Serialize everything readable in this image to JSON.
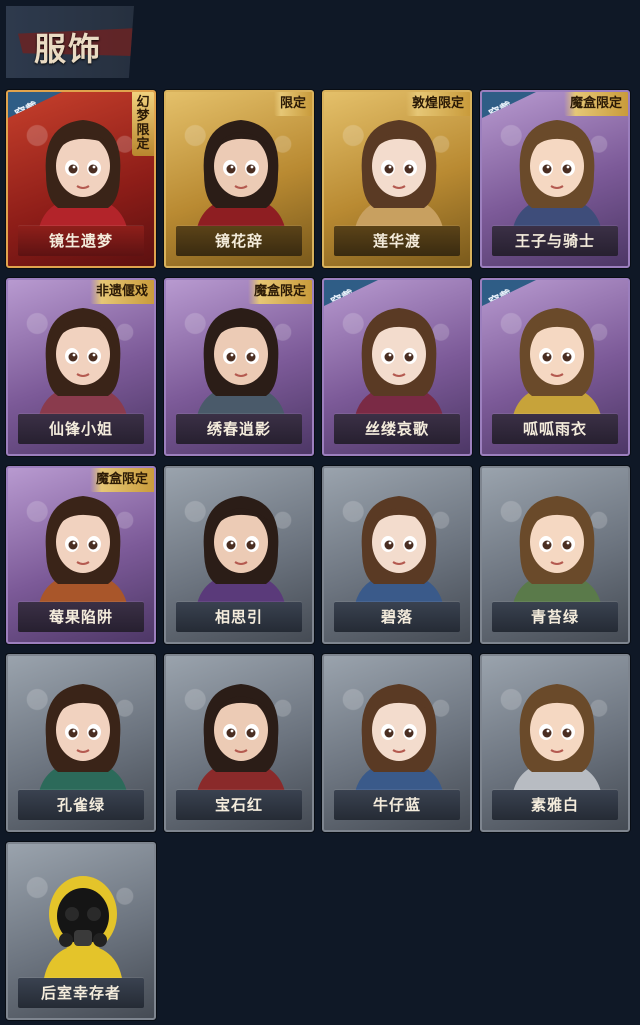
{
  "header": {
    "title": "服饰"
  },
  "labels": {
    "equipped": "穿戴"
  },
  "outfits": [
    {
      "name": "镜生遗梦",
      "rarity": "red",
      "equipped": true,
      "tag": "幻梦限定",
      "icon": "character-portrait"
    },
    {
      "name": "镜花辞",
      "rarity": "gold",
      "equipped": false,
      "tag": "限定",
      "icon": "character-portrait"
    },
    {
      "name": "莲华渡",
      "rarity": "gold",
      "equipped": false,
      "tag": "敦煌限定",
      "icon": "character-portrait"
    },
    {
      "name": "王子与骑士",
      "rarity": "purple",
      "equipped": true,
      "tag": "魔盒限定",
      "icon": "character-portrait"
    },
    {
      "name": "仙锋小姐",
      "rarity": "purple",
      "equipped": false,
      "tag": "非遗偃戏",
      "icon": "character-portrait"
    },
    {
      "name": "绣春逍影",
      "rarity": "purple",
      "equipped": false,
      "tag": "魔盒限定",
      "icon": "character-portrait"
    },
    {
      "name": "丝缕哀歌",
      "rarity": "purple",
      "equipped": true,
      "tag": "",
      "icon": "character-portrait"
    },
    {
      "name": "呱呱雨衣",
      "rarity": "purple",
      "equipped": true,
      "tag": "",
      "icon": "character-portrait"
    },
    {
      "name": "莓果陷阱",
      "rarity": "purple",
      "equipped": false,
      "tag": "魔盒限定",
      "icon": "character-portrait"
    },
    {
      "name": "相思引",
      "rarity": "silver",
      "equipped": false,
      "tag": "",
      "icon": "character-portrait"
    },
    {
      "name": "碧落",
      "rarity": "silver",
      "equipped": false,
      "tag": "",
      "icon": "character-portrait"
    },
    {
      "name": "青苔绿",
      "rarity": "silver",
      "equipped": false,
      "tag": "",
      "icon": "character-portrait"
    },
    {
      "name": "孔雀绿",
      "rarity": "silver",
      "equipped": false,
      "tag": "",
      "icon": "character-portrait"
    },
    {
      "name": "宝石红",
      "rarity": "silver",
      "equipped": false,
      "tag": "",
      "icon": "character-portrait"
    },
    {
      "name": "牛仔蓝",
      "rarity": "silver",
      "equipped": false,
      "tag": "",
      "icon": "character-portrait"
    },
    {
      "name": "素雅白",
      "rarity": "silver",
      "equipped": false,
      "tag": "",
      "icon": "character-portrait"
    },
    {
      "name": "后室幸存者",
      "rarity": "silver",
      "equipped": false,
      "tag": "",
      "icon": "hazmat-portrait"
    }
  ]
}
